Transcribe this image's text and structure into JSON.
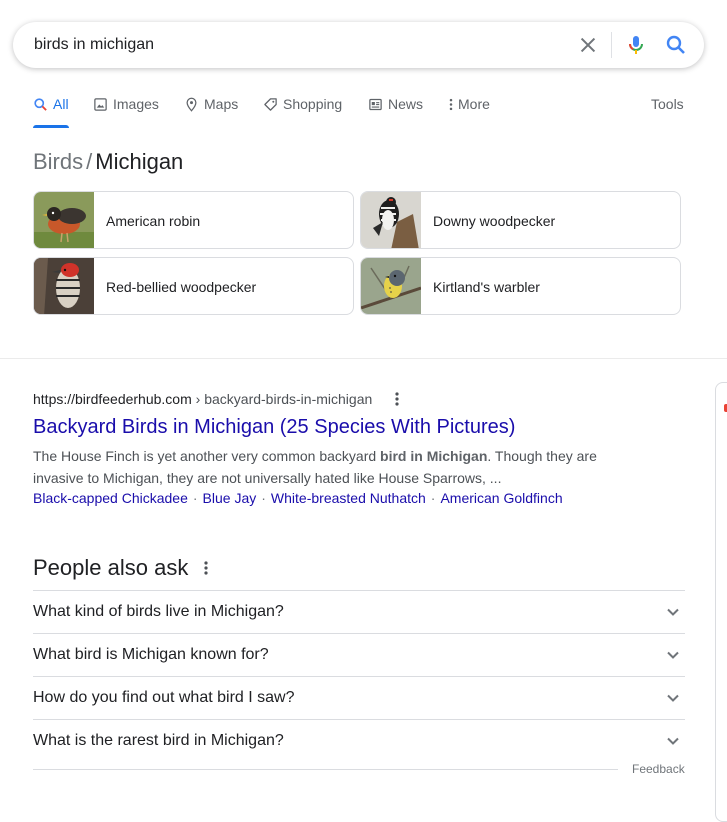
{
  "search": {
    "query": "birds in michigan"
  },
  "tabs": [
    {
      "label": "All",
      "icon": "search-icon",
      "active": true
    },
    {
      "label": "Images",
      "icon": "image-icon"
    },
    {
      "label": "Maps",
      "icon": "map-pin-icon"
    },
    {
      "label": "Shopping",
      "icon": "tag-icon"
    },
    {
      "label": "News",
      "icon": "news-icon"
    },
    {
      "label": "More",
      "icon": "vertical-dots-icon"
    }
  ],
  "tools_label": "Tools",
  "breadcrumb": {
    "parent": "Birds",
    "separator": "/",
    "current": "Michigan"
  },
  "birds": [
    {
      "label": "American robin"
    },
    {
      "label": "Downy woodpecker"
    },
    {
      "label": "Red-bellied woodpecker"
    },
    {
      "label": "Kirtland's warbler"
    }
  ],
  "result": {
    "url_host": "https://birdfeederhub.com",
    "url_path": " › backyard-birds-in-michigan",
    "title": "Backyard Birds in Michigan (25 Species With Pictures)",
    "snippet_pre": "The House Finch is yet another very common backyard ",
    "snippet_bold": "bird in Michigan",
    "snippet_post": ". Though they are invasive to Michigan, they are not universally hated like House Sparrows, ...",
    "sitelinks": [
      "Black-capped Chickadee",
      "Blue Jay",
      "White-breasted Nuthatch",
      "American Goldfinch"
    ]
  },
  "people_also_ask": {
    "title": "People also ask",
    "questions": [
      "What kind of birds live in Michigan?",
      "What bird is Michigan known for?",
      "How do you find out what bird I saw?",
      "What is the rarest bird in Michigan?"
    ]
  },
  "feedback_label": "Feedback",
  "colors": {
    "link": "#1a0dab",
    "accent": "#1a73e8"
  }
}
